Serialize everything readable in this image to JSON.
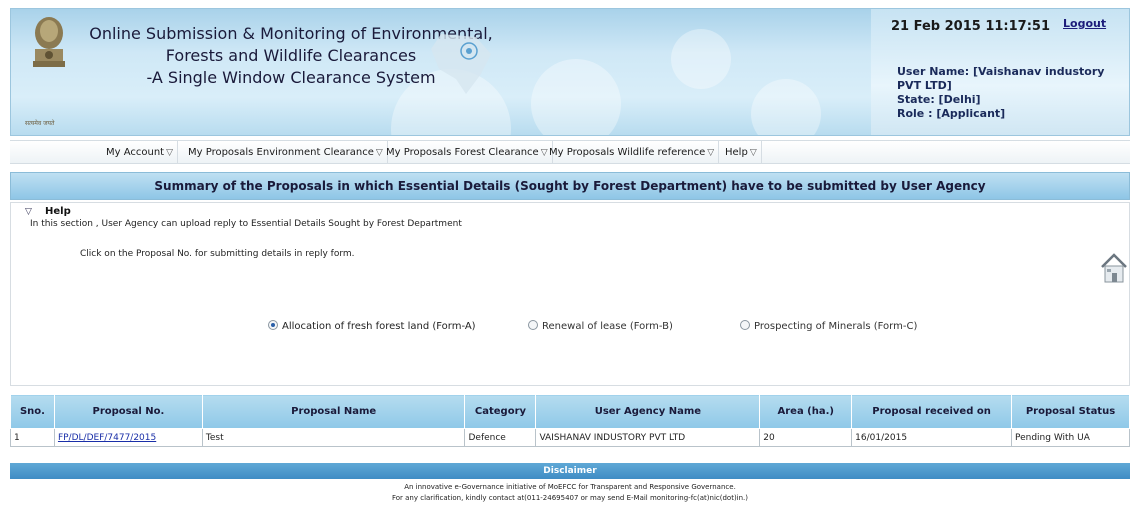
{
  "header": {
    "emblem_motto": "सत्यमेव जयते",
    "title_lines": [
      "Online Submission & Monitoring of Environmental,",
      "Forests and Wildlife Clearances",
      "-A Single Window Clearance System"
    ],
    "datetime": "21 Feb 2015 11:17:51",
    "logout": "Logout",
    "user_name": "User Name: [Vaishanav industory PVT LTD]",
    "state": "State: [Delhi]",
    "role": "Role : [Applicant]"
  },
  "nav": {
    "items": [
      "My Account",
      "My Proposals Environment Clearance",
      "My Proposals Forest Clearance",
      "My Proposals Wildlife reference",
      "Help"
    ]
  },
  "summary_title": "Summary of the Proposals in which Essential Details (Sought by Forest Department) have to be submitted by User Agency",
  "help": {
    "title": "Help",
    "line1": "In this section , User Agency can upload reply to Essential Details Sought by Forest Department",
    "line2": "Click on the Proposal No. for submitting details in reply form."
  },
  "radios": [
    {
      "label": "Allocation of fresh forest land (Form-A)",
      "checked": true
    },
    {
      "label": "Renewal of lease (Form-B)",
      "checked": false
    },
    {
      "label": "Prospecting of Minerals (Form-C)",
      "checked": false
    }
  ],
  "table": {
    "headers": [
      "Sno.",
      "Proposal No.",
      "Proposal Name",
      "Category",
      "User Agency Name",
      "Area (ha.)",
      "Proposal received on",
      "Proposal Status"
    ],
    "rows": [
      [
        "1",
        "FP/DL/DEF/7477/2015",
        "Test",
        "Defence",
        "VAISHANAV INDUSTORY PVT LTD",
        "20",
        "16/01/2015",
        "Pending With UA"
      ]
    ]
  },
  "footer": {
    "disclaimer": "Disclaimer",
    "line1": "An innovative e-Governance initiative of MoEFCC for Transparent and Responsive Governance.",
    "line2": "For any clarification, kindly contact at(011-24695407 or may send E-Mail monitoring-fc(at)nic(dot)in.)"
  },
  "colors": {
    "header_blue": "#a9d2ea",
    "table_header": "#8ec8e8",
    "disclaimer_bar": "#3f8cc4",
    "link": "#1a2fa8"
  }
}
